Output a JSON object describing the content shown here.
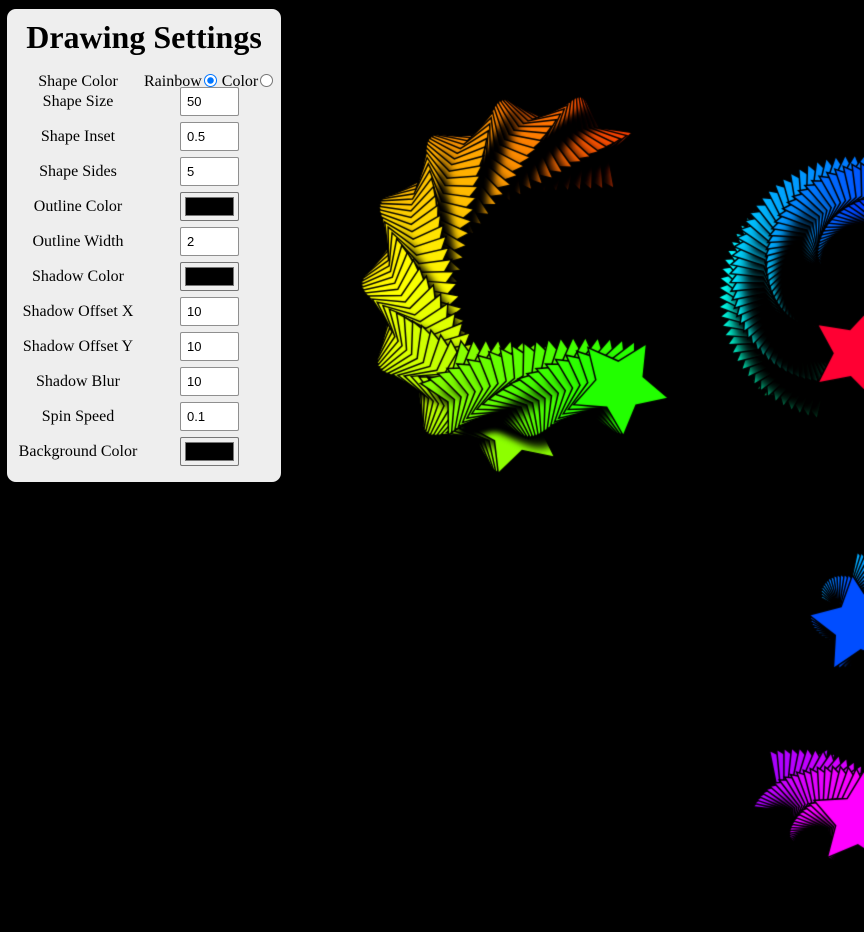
{
  "panel": {
    "title": "Drawing Settings",
    "shape_color_label": "Shape Color",
    "rainbow_label": "Rainbow",
    "color_label": "Color",
    "color_mode": "Rainbow",
    "fields": [
      {
        "label": "Shape Size",
        "value": "50"
      },
      {
        "label": "Shape Inset",
        "value": "0.5"
      },
      {
        "label": "Shape Sides",
        "value": "5"
      },
      {
        "label": "Outline Color",
        "color": "#000000"
      },
      {
        "label": "Outline Width",
        "value": "2"
      },
      {
        "label": "Shadow Color",
        "color": "#000000"
      },
      {
        "label": "Shadow Offset X",
        "value": "10"
      },
      {
        "label": "Shadow Offset Y",
        "value": "10"
      },
      {
        "label": "Shadow Blur",
        "value": "10"
      },
      {
        "label": "Spin Speed",
        "value": "0.1"
      },
      {
        "label": "Background Color",
        "color": "#000000"
      }
    ]
  },
  "colors": {
    "background": "#000000",
    "panel": "#eeeeee",
    "radio_selected": "#0075ff"
  }
}
